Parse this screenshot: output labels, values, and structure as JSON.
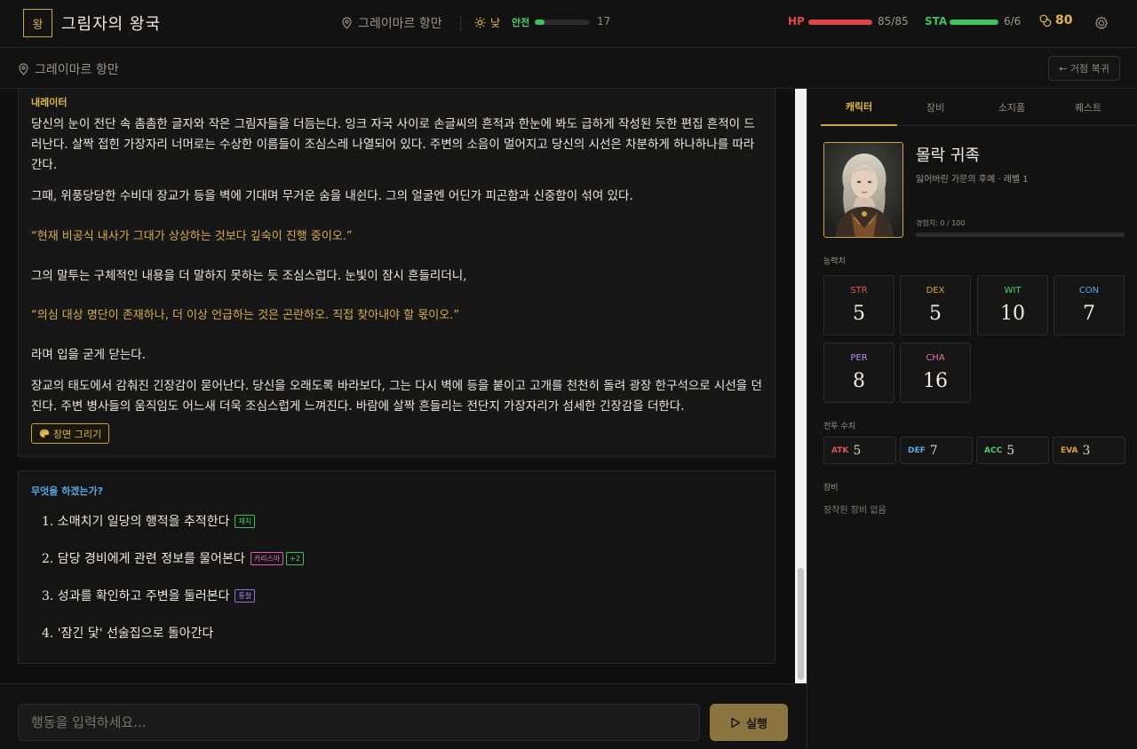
{
  "app": {
    "logo": "왕",
    "title": "그림자의 왕국"
  },
  "header": {
    "location": "그레이마르 항만",
    "time_label": "낮",
    "safety_label": "안전",
    "safety_value": 17,
    "safety_fraction": 0.17,
    "hp_label": "HP",
    "hp_value": "85/85",
    "hp_fraction": 1.0,
    "sta_label": "STA",
    "sta_value": "6/6",
    "sta_fraction": 1.0,
    "gold": "80",
    "icons": {
      "location": "map-pin-icon",
      "time": "sun-icon",
      "gold": "coins-icon",
      "settings": "gear-icon"
    }
  },
  "subbar": {
    "location": "그레이마르 항만",
    "restore_label": "← 거점 복귀"
  },
  "narration": {
    "label": "내레이터",
    "paragraphs": [
      "당신의 눈이 전단 속 촘촘한 글자와 작은 그림자들을 더듬는다. 잉크 자국 사이로 손글씨의 흔적과 한눈에 봐도 급하게 작성된 듯한 편집 흔적이 드러난다. 살짝 접힌 가장자리 너머로는 수상한 이름들이 조심스레 나열되어 있다. 주변의 소음이 멀어지고 당신의 시선은 차분하게 하나하나를 따라간다.",
      "그때, 위풍당당한 수비대 장교가 등을 벽에 기대며 무거운 숨을 내쉰다. 그의 얼굴엔 어딘가 피곤함과 신중함이 섞여 있다.",
      "“현재 비공식 내사가 그대가 상상하는 것보다 깊숙이 진행 중이오.”",
      "그의 말투는 구체적인 내용을 더 말하지 못하는 듯 조심스럽다. 눈빛이 잠시 흔들리더니,",
      "“의심 대상 명단이 존재하나, 더 이상 언급하는 것은 곤란하오. 직접 찾아내야 할 몫이오.”",
      "라며 입을 굳게 닫는다.",
      "장교의 태도에서 감춰진 긴장감이 묻어난다. 당신을 오래도록 바라보다, 그는 다시 벽에 등을 붙이고 고개를 천천히 돌려 광장 한구석으로 시선을 던진다. 주변 병사들의 움직임도 어느새 더욱 조심스럽게 느껴진다. 바람에 살짝 흔들리는 전단지 가장자리가 섬세한 긴장감을 더한다."
    ],
    "scene_button": "장면 그리기"
  },
  "choices": {
    "title": "무엇을 하겠는가?",
    "items": [
      {
        "text": "1. 소매치기 일당의 행적을 추적한다",
        "tags": [
          {
            "label": "재치",
            "color": "green"
          }
        ]
      },
      {
        "text": "2. 담당 경비에게 관련 정보를 물어본다",
        "tags": [
          {
            "label": "카리스마",
            "color": "pink"
          },
          {
            "label": "+2",
            "color": "green"
          }
        ]
      },
      {
        "text": "3. 성과를 확인하고 주변을 둘러본다",
        "tags": [
          {
            "label": "통찰",
            "color": "purple"
          }
        ]
      },
      {
        "text": "4. '잠긴 닻' 선술집으로 돌아간다",
        "tags": []
      }
    ]
  },
  "input": {
    "placeholder": "행동을 입력하세요...",
    "run_label": "실행"
  },
  "panel": {
    "tabs": [
      "캐릭터",
      "장비",
      "소지품",
      "퀘스트"
    ],
    "active_tab": 0,
    "character": {
      "name": "몰락 귀족",
      "subtitle": "잃어버린 가문의 후예 · 레벨 1",
      "exp_label": "경험치: 0 / 100",
      "exp_fraction": 0
    },
    "stats_label": "능력치",
    "stats": [
      {
        "name": "STR",
        "value": "5",
        "color": "#e05555"
      },
      {
        "name": "DEX",
        "value": "5",
        "color": "#e0a040"
      },
      {
        "name": "WIT",
        "value": "10",
        "color": "#4cd06a"
      },
      {
        "name": "CON",
        "value": "7",
        "color": "#5aa8e8"
      },
      {
        "name": "PER",
        "value": "8",
        "color": "#b28af0"
      },
      {
        "name": "CHA",
        "value": "16",
        "color": "#ec70b8"
      }
    ],
    "combat_label": "전투 수치",
    "combat": [
      {
        "name": "ATK",
        "value": "5",
        "color": "#e05555"
      },
      {
        "name": "DEF",
        "value": "7",
        "color": "#5aa8e8"
      },
      {
        "name": "ACC",
        "value": "5",
        "color": "#4cd06a"
      },
      {
        "name": "EVA",
        "value": "3",
        "color": "#e0a040"
      }
    ],
    "equipment_label": "장비",
    "equipment_empty": "장착된 장비 없음"
  }
}
